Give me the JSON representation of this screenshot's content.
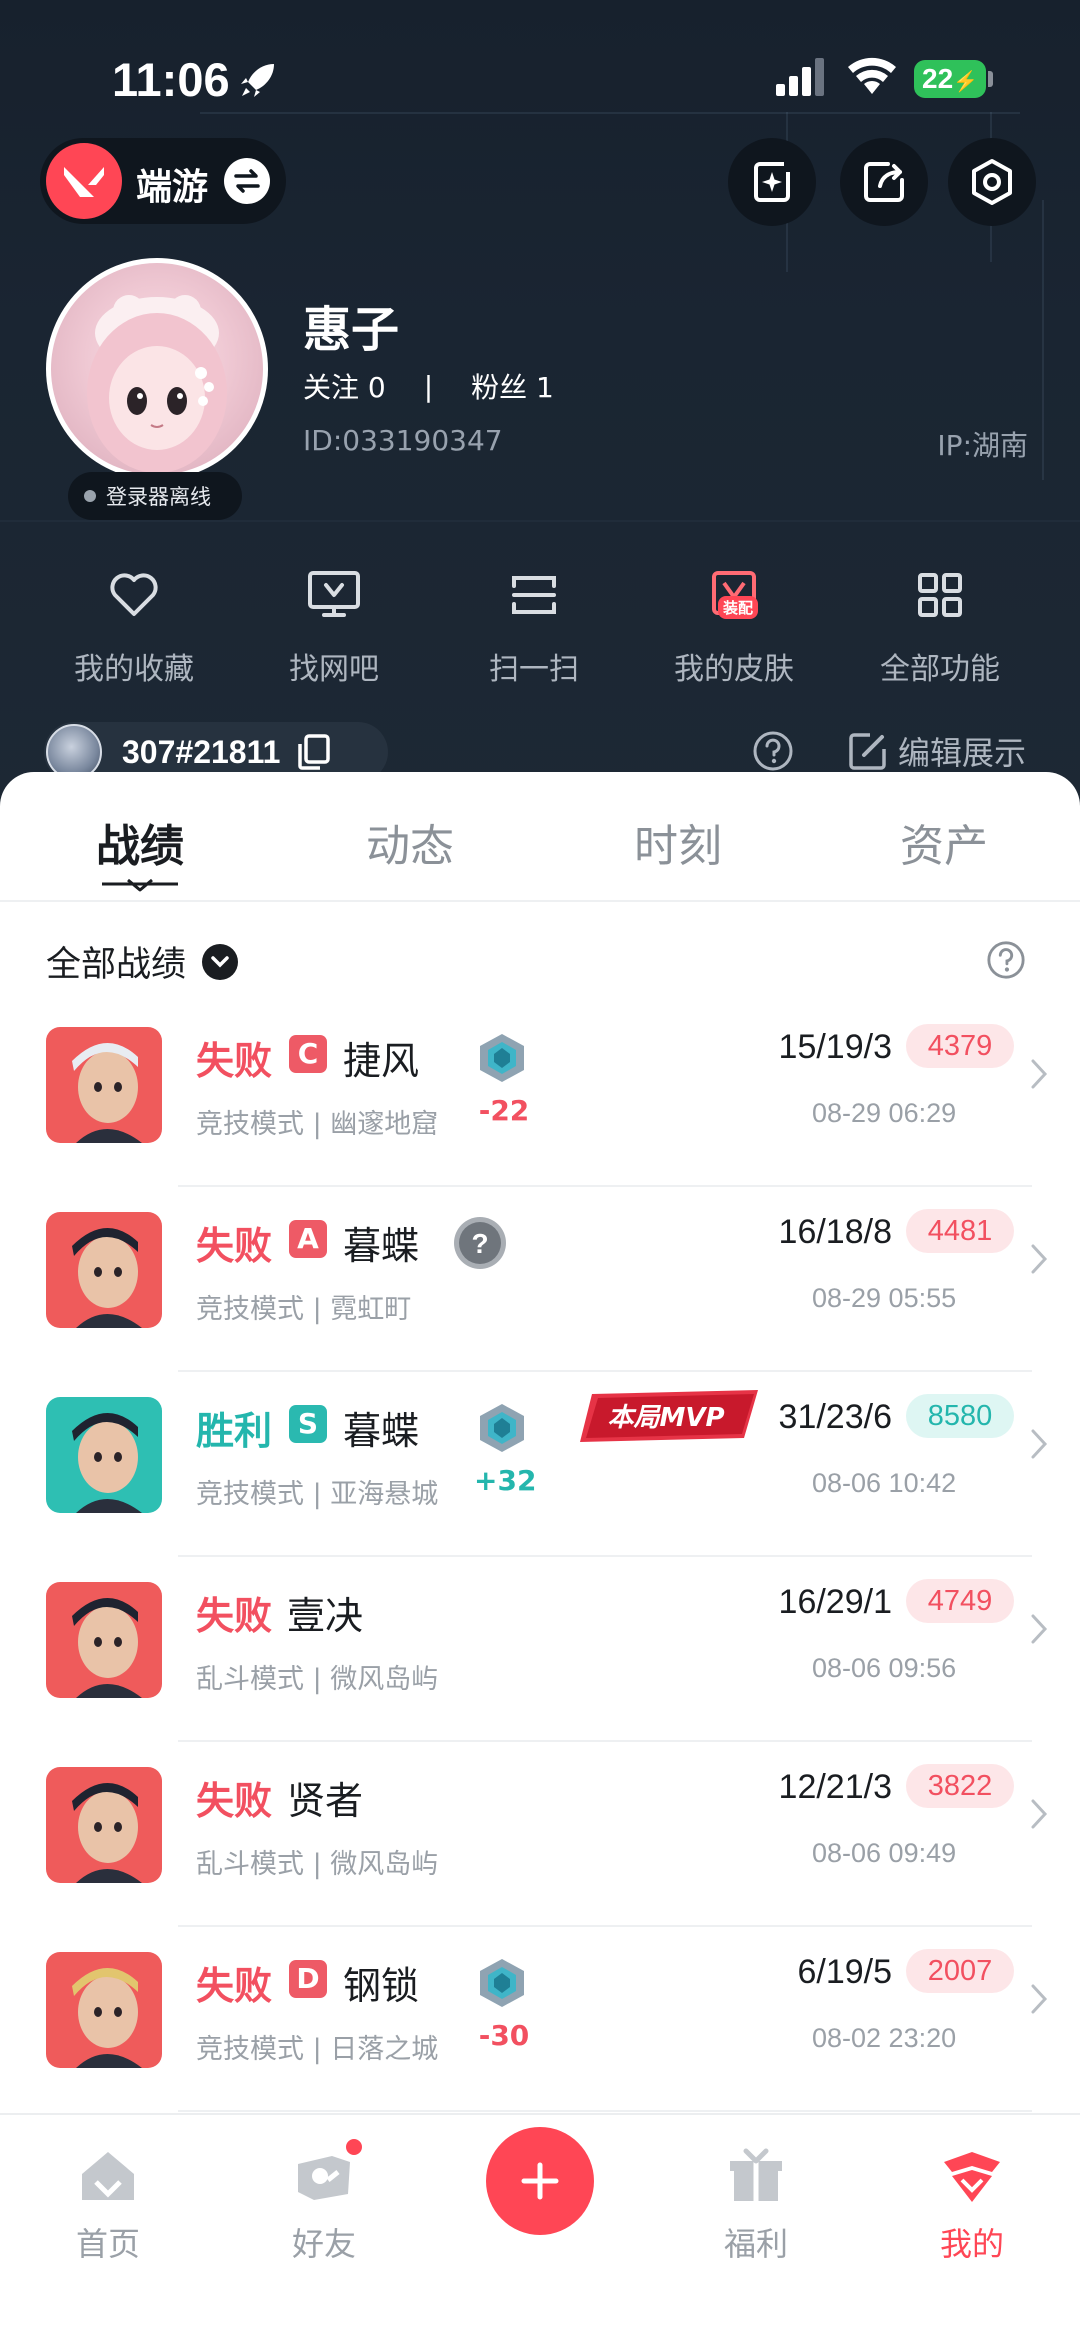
{
  "status_bar": {
    "time": "11:06",
    "battery": "22"
  },
  "header": {
    "brand": "端游",
    "user": {
      "name": "惠子",
      "follow_label": "关注 0",
      "fans_label": "粉丝 1",
      "separator": "|",
      "id": "ID:033190347",
      "ip": "IP:湖南",
      "online_status": "登录器离线"
    },
    "quick_actions": [
      {
        "label": "我的收藏",
        "icon": "heart-icon"
      },
      {
        "label": "找网吧",
        "icon": "monitor-icon"
      },
      {
        "label": "扫一扫",
        "icon": "scan-icon"
      },
      {
        "label": "我的皮肤",
        "icon": "skin-icon",
        "tag": "装配"
      },
      {
        "label": "全部功能",
        "icon": "grid-icon"
      }
    ],
    "account": {
      "name": "307#21811"
    },
    "edit_label": "编辑展示"
  },
  "tabs": [
    "战绩",
    "动态",
    "时刻",
    "资产"
  ],
  "filter": {
    "label": "全部战绩"
  },
  "matches": [
    {
      "result": "失败",
      "outcome": "lose",
      "rank": "C",
      "rank_color": "#ee5a66",
      "agent": "捷风",
      "mode": "竞技模式 | 幽邃地窟",
      "tier": "tier-icon",
      "rr": "-22",
      "kda": "15/19/3",
      "score": "4379",
      "date": "08-29 06:29",
      "agent_bg": "#ef5b5b"
    },
    {
      "result": "失败",
      "outcome": "lose",
      "rank": "A",
      "rank_color": "#ee5a66",
      "agent": "暮蝶",
      "mode": "竞技模式 | 霓虹町",
      "tier": "unknown-tier-icon",
      "rr": "",
      "kda": "16/18/8",
      "score": "4481",
      "date": "08-29 05:55",
      "agent_bg": "#ef5b5b"
    },
    {
      "result": "胜利",
      "outcome": "win",
      "rank": "S",
      "rank_color": "#2ab9b0",
      "agent": "暮蝶",
      "mode": "竞技模式 | 亚海悬城",
      "tier": "tier-icon",
      "rr": "+32",
      "kda": "31/23/6",
      "score": "8580",
      "date": "08-06 10:42",
      "agent_bg": "#2ebfb3",
      "mvp": "本局MVP"
    },
    {
      "result": "失败",
      "outcome": "lose",
      "rank": "",
      "rank_color": "",
      "agent": "壹决",
      "mode": "乱斗模式 | 微风岛屿",
      "tier": "",
      "rr": "",
      "kda": "16/29/1",
      "score": "4749",
      "date": "08-06 09:56",
      "agent_bg": "#ef5b5b"
    },
    {
      "result": "失败",
      "outcome": "lose",
      "rank": "",
      "rank_color": "",
      "agent": "贤者",
      "mode": "乱斗模式 | 微风岛屿",
      "tier": "",
      "rr": "",
      "kda": "12/21/3",
      "score": "3822",
      "date": "08-06 09:49",
      "agent_bg": "#ef5b5b"
    },
    {
      "result": "失败",
      "outcome": "lose",
      "rank": "D",
      "rank_color": "#ee5a66",
      "agent": "钢锁",
      "mode": "竞技模式 | 日落之城",
      "tier": "tier-icon",
      "rr": "-30",
      "kda": "6/19/5",
      "score": "2007",
      "date": "08-02 23:20",
      "agent_bg": "#ef5b5b"
    }
  ],
  "bottom_nav": [
    {
      "label": "首页",
      "icon": "home-icon"
    },
    {
      "label": "好友",
      "icon": "friends-icon"
    },
    {
      "label": "",
      "icon": "plus-icon"
    },
    {
      "label": "福利",
      "icon": "gift-icon"
    },
    {
      "label": "我的",
      "icon": "profile-icon"
    }
  ],
  "colors": {
    "accent": "#ff4655",
    "lose": "#f25060",
    "win": "#24b6ad",
    "header_bg": "#1a2532"
  }
}
